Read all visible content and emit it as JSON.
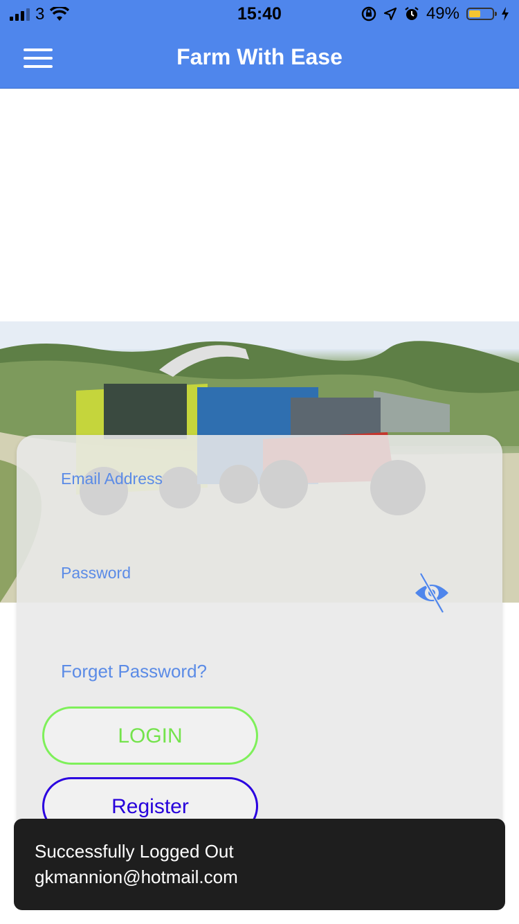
{
  "status_bar": {
    "carrier": "3",
    "time": "15:40",
    "battery_percent": "49%",
    "battery_level": 0.49,
    "icons": [
      "signal-icon",
      "wifi-icon",
      "orientation-lock-icon",
      "location-icon",
      "alarm-icon",
      "battery-icon",
      "charging-icon"
    ]
  },
  "header": {
    "title": "Farm With Ease",
    "menu_icon": "hamburger-menu-icon",
    "color": "#4f86ec"
  },
  "hero": {
    "image_description_icon": "farm-harvest-image"
  },
  "login_form": {
    "email_placeholder": "Email Address",
    "password_placeholder": "Password",
    "password_visibility_icon": "eye-off-icon",
    "forgot_password": "Forget Password?",
    "login_button": "LOGIN",
    "register_button": "Register",
    "accent_color": "#5b8be6",
    "login_color": "#74e34c",
    "register_color": "#2600db"
  },
  "toast": {
    "line1": "Successfully Logged Out",
    "line2": "gkmannion@hotmail.com"
  }
}
